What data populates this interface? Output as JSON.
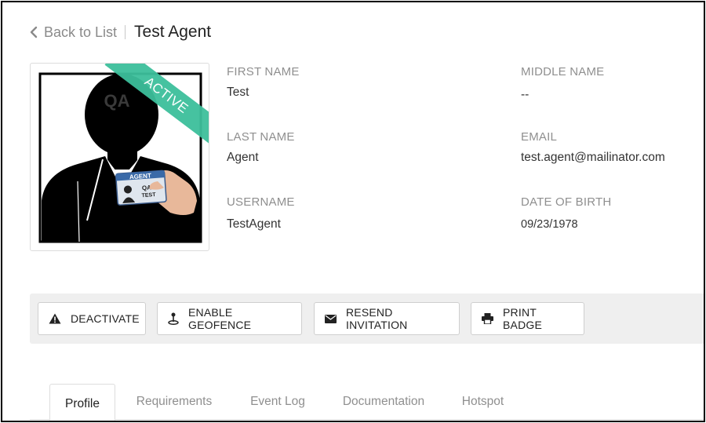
{
  "header": {
    "back_label": "Back to List",
    "title": "Test Agent"
  },
  "photo": {
    "status_ribbon": "ACTIVE",
    "badge_title": "AGENT",
    "badge_line1": "QA",
    "badge_line2": "TEST",
    "badge_watermark": "QA",
    "ribbon_color": "#3dbf9b"
  },
  "details": {
    "first_name": {
      "label": "FIRST NAME",
      "value": "Test"
    },
    "middle_name": {
      "label": "MIDDLE NAME",
      "value": "--"
    },
    "last_name": {
      "label": "LAST NAME",
      "value": "Agent"
    },
    "email": {
      "label": "EMAIL",
      "value": "test.agent@mailinator.com"
    },
    "username": {
      "label": "USERNAME",
      "value": "TestAgent"
    },
    "dob": {
      "label": "DATE OF BIRTH",
      "value": "09/23/1978"
    }
  },
  "actions": {
    "deactivate": {
      "label": "DEACTIVATE",
      "icon": "warning-icon"
    },
    "geofence": {
      "label": "ENABLE GEOFENCE",
      "icon": "geofence-pin-icon"
    },
    "resend": {
      "label": "RESEND INVITATION",
      "icon": "envelope-icon"
    },
    "print": {
      "label": "PRINT BADGE",
      "icon": "printer-icon"
    }
  },
  "tabs": [
    {
      "label": "Profile",
      "active": true
    },
    {
      "label": "Requirements",
      "active": false
    },
    {
      "label": "Event Log",
      "active": false
    },
    {
      "label": "Documentation",
      "active": false
    },
    {
      "label": "Hotspot",
      "active": false
    }
  ]
}
